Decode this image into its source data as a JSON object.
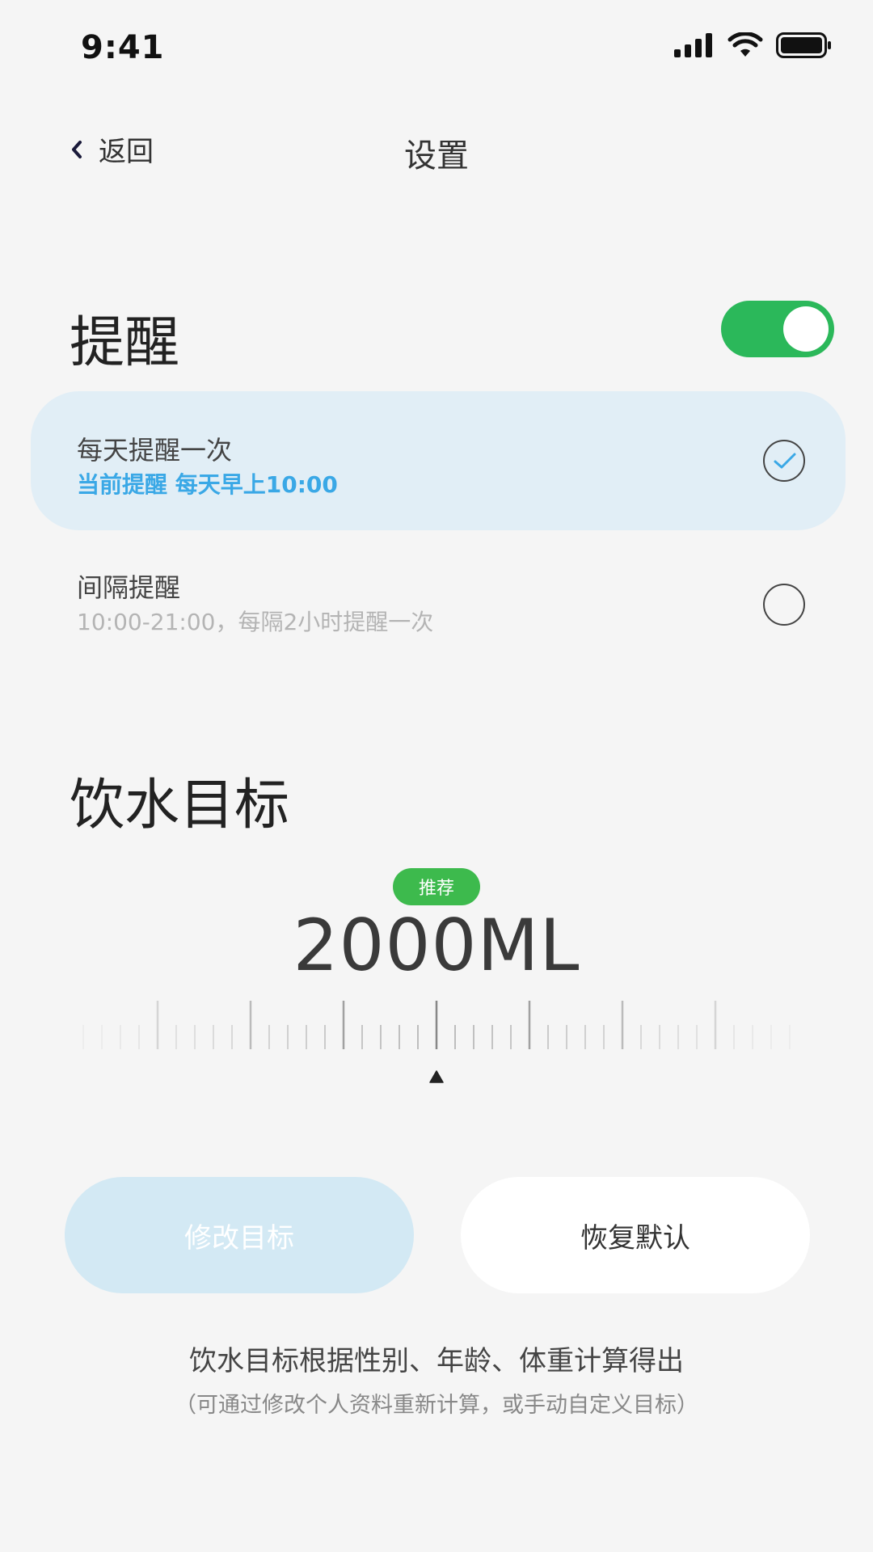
{
  "status_bar": {
    "time": "9:41"
  },
  "nav": {
    "back_label": "返回",
    "title": "设置"
  },
  "reminder": {
    "title": "提醒",
    "enabled": true,
    "options": [
      {
        "title": "每天提醒一次",
        "subtitle": "当前提醒 每天早上10:00",
        "selected": true
      },
      {
        "title": "间隔提醒",
        "subtitle": "10:00-21:00，每隔2小时提醒一次",
        "selected": false
      }
    ]
  },
  "goal": {
    "title": "饮水目标",
    "badge": "推荐",
    "value": "2000ML"
  },
  "buttons": {
    "edit": "修改目标",
    "reset": "恢复默认"
  },
  "note": {
    "main": "饮水目标根据性别、年龄、体重计算得出",
    "sub": "（可通过修改个人资料重新计算，或手动自定义目标）"
  },
  "colors": {
    "accent_green": "#2bb85a",
    "accent_blue": "#3aa8e6",
    "selected_bg": "#e1eef6",
    "edit_button_bg": "#d3e9f4"
  }
}
